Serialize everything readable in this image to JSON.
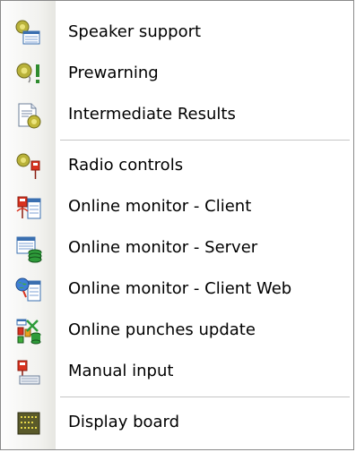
{
  "menu": {
    "items": [
      {
        "label": "Speaker support",
        "icon": "speaker-support-icon"
      },
      {
        "label": "Prewarning",
        "icon": "prewarning-icon"
      },
      {
        "label": "Intermediate Results",
        "icon": "intermediate-results-icon"
      },
      {
        "label": "Radio controls",
        "icon": "radio-controls-icon"
      },
      {
        "label": "Online monitor - Client",
        "icon": "online-monitor-client-icon"
      },
      {
        "label": "Online monitor - Server",
        "icon": "online-monitor-server-icon"
      },
      {
        "label": "Online monitor - Client Web",
        "icon": "online-monitor-client-web-icon"
      },
      {
        "label": "Online punches update",
        "icon": "online-punches-update-icon"
      },
      {
        "label": "Manual input",
        "icon": "manual-input-icon"
      },
      {
        "label": "Display board",
        "icon": "display-board-icon"
      }
    ]
  },
  "colors": {
    "gutter": "#f0f0ec",
    "border": "#8a8a8a",
    "separator": "#c5c5c5",
    "text": "#000000"
  }
}
